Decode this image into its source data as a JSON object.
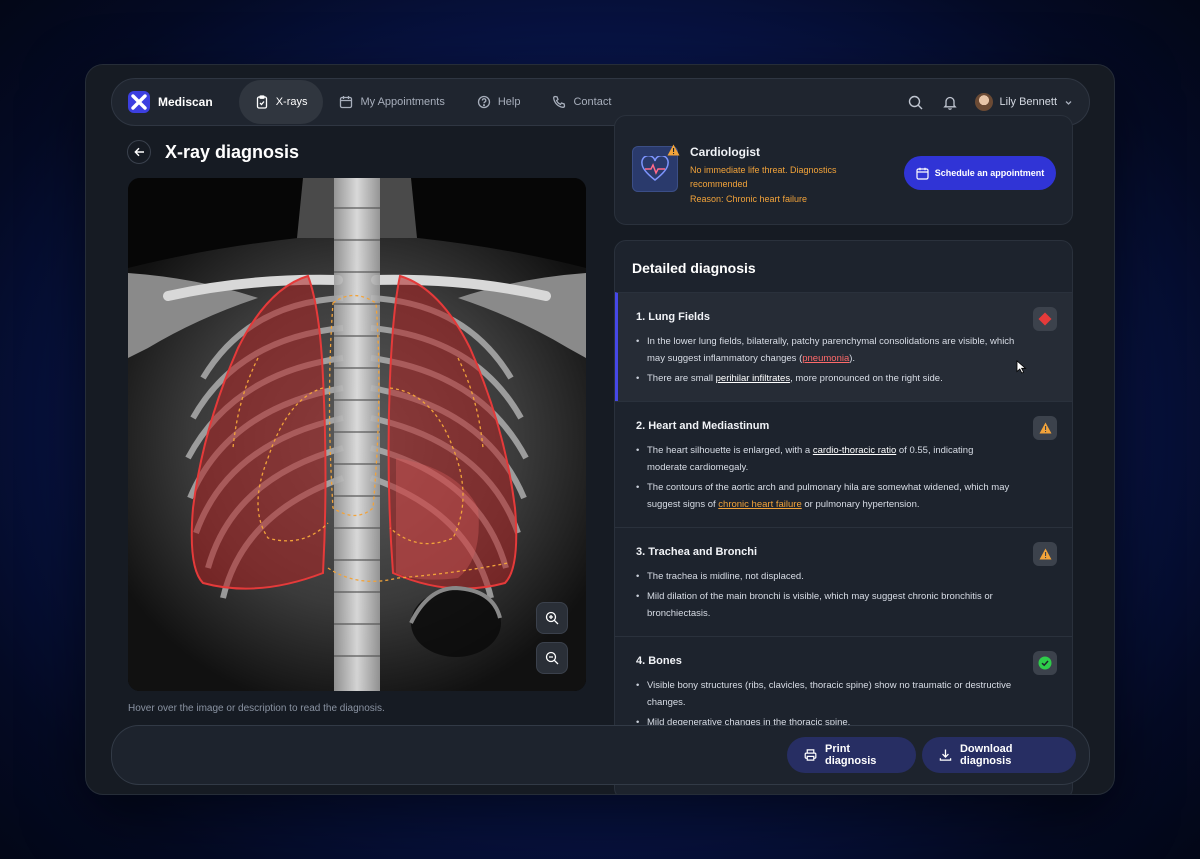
{
  "brand": {
    "name": "Mediscan",
    "accent": "#3c3fe0"
  },
  "nav": {
    "items": [
      {
        "label": "X-rays",
        "icon": "clipboard-icon",
        "active": true
      },
      {
        "label": "My Appointments",
        "icon": "calendar-icon",
        "active": false
      },
      {
        "label": "Help",
        "icon": "help-circle-icon",
        "active": false
      },
      {
        "label": "Contact",
        "icon": "phone-icon",
        "active": false
      }
    ],
    "user": {
      "name": "Lily Bennett"
    }
  },
  "page": {
    "title": "X-ray diagnosis",
    "hint": "Hover over the image or description to read the diagnosis."
  },
  "doctor_card": {
    "title": "Cardiologist",
    "message": "No immediate life threat. Diagnostics recommended",
    "reason": "Reason: Chronic heart failure",
    "schedule_label": "Schedule an appointment",
    "warning_color": "#f2a33a"
  },
  "diagnosis": {
    "title": "Detailed diagnosis",
    "sections": [
      {
        "title": "1. Lung Fields",
        "status": "critical",
        "b1_pre": "In the lower lung fields, bilaterally, patchy parenchymal consolidations are visible, which may suggest inflammatory changes (",
        "b1_link": "pneumonia",
        "b1_post": ").",
        "b2_pre": "There are small ",
        "b2_link": "perihilar infiltrates",
        "b2_post": ", more pronounced on the right side."
      },
      {
        "title": "2. Heart and Mediastinum",
        "status": "warning",
        "b1_pre": "The heart silhouette is enlarged, with a ",
        "b1_link": "cardio-thoracic ratio",
        "b1_post": " of 0.55, indicating moderate cardiomegaly.",
        "b2_pre": "The contours of the aortic arch and pulmonary hila are somewhat widened, which may suggest signs of ",
        "b2_link": "chronic heart failure",
        "b2_post": " or pulmonary hypertension."
      },
      {
        "title": "3. Trachea and Bronchi",
        "status": "warning",
        "b1": "The trachea is midline, not displaced.",
        "b2": "Mild dilation of the main bronchi is visible, which may suggest chronic bronchitis or bronchiectasis."
      },
      {
        "title": "4. Bones",
        "status": "ok",
        "b1": "Visible bony structures (ribs, clavicles, thoracic spine) show no traumatic or destructive changes.",
        "b2": "Mild degenerative changes in the thoracic spine."
      }
    ]
  },
  "actions": {
    "print_label": "Print diagnosis",
    "download_label": "Download diagnosis"
  },
  "colors": {
    "critical": "#e53a3a",
    "warning": "#f2a33a",
    "ok": "#2ecc4a",
    "primary_button": "#3034d6",
    "secondary_button": "#272e63"
  }
}
